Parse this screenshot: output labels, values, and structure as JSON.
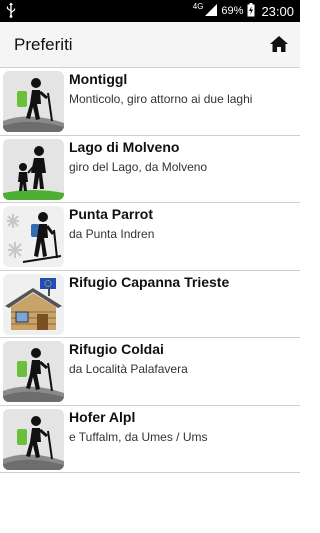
{
  "status_bar": {
    "network": "4G",
    "battery": "69%",
    "time": "23:00",
    "icons": [
      "usb-icon",
      "signal-icon",
      "battery-charging-icon"
    ]
  },
  "app_bar": {
    "title": "Preferiti",
    "home_icon": "home-icon"
  },
  "favorites": [
    {
      "title": "Montiggl",
      "subtitle": "Monticolo, giro attorno ai due laghi",
      "icon": "hiker-icon"
    },
    {
      "title": "Lago di Molveno",
      "subtitle": "giro del Lago, da Molveno",
      "icon": "family-walk-icon"
    },
    {
      "title": "Punta Parrot",
      "subtitle": "da Punta Indren",
      "icon": "ski-tour-icon"
    },
    {
      "title": "Rifugio Capanna Trieste",
      "subtitle": "",
      "icon": "hut-icon"
    },
    {
      "title": "Rifugio Coldai",
      "subtitle": "da Località Palafavera",
      "icon": "hiker-icon"
    },
    {
      "title": "Hofer Alpl",
      "subtitle": "e Tuffalm, da Umes / Ums",
      "icon": "hiker-icon"
    }
  ],
  "colors": {
    "status_bar": "#000000",
    "app_bar": "#f5f5f5",
    "backpack_green": "#6cbf3a",
    "slope_gray": "#8a8a8a",
    "grass_green": "#4caf34",
    "snow_blue": "#2f6db5",
    "flag_blue": "#1f4fb6",
    "hut_wood": "#c9a46a"
  }
}
